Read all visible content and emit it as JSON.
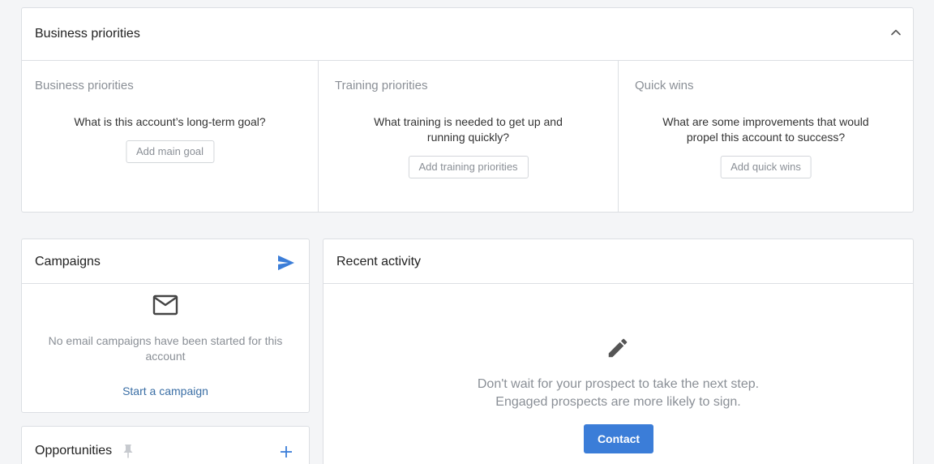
{
  "business_priorities": {
    "title": "Business priorities",
    "columns": [
      {
        "title": "Business priorities",
        "question": "What is this account’s long-term goal?",
        "button": "Add main goal"
      },
      {
        "title": "Training priorities",
        "question": "What training is needed to get up and running quickly?",
        "button": "Add training priorities"
      },
      {
        "title": "Quick wins",
        "question": "What are some improvements that would propel this account to success?",
        "button": "Add quick wins"
      }
    ],
    "collapse_icon": "chevron-up-icon"
  },
  "campaigns": {
    "title": "Campaigns",
    "header_icon": "send-icon",
    "empty_icon": "mail-icon",
    "empty_text": "No email campaigns have been started for this account",
    "link": "Start a campaign"
  },
  "opportunities": {
    "title": "Opportunities",
    "pin_icon": "pin-icon",
    "add_icon": "plus-icon"
  },
  "recent_activity": {
    "title": "Recent activity",
    "icon": "pencil-icon",
    "message_line1": "Don't wait for your prospect to take the next step.",
    "message_line2": "Engaged prospects are more likely to sign.",
    "button": "Contact"
  },
  "colors": {
    "accent": "#3b7dd8",
    "link": "#3a6ea5",
    "muted_text": "#8a8f96",
    "border": "#dcdfe3"
  }
}
